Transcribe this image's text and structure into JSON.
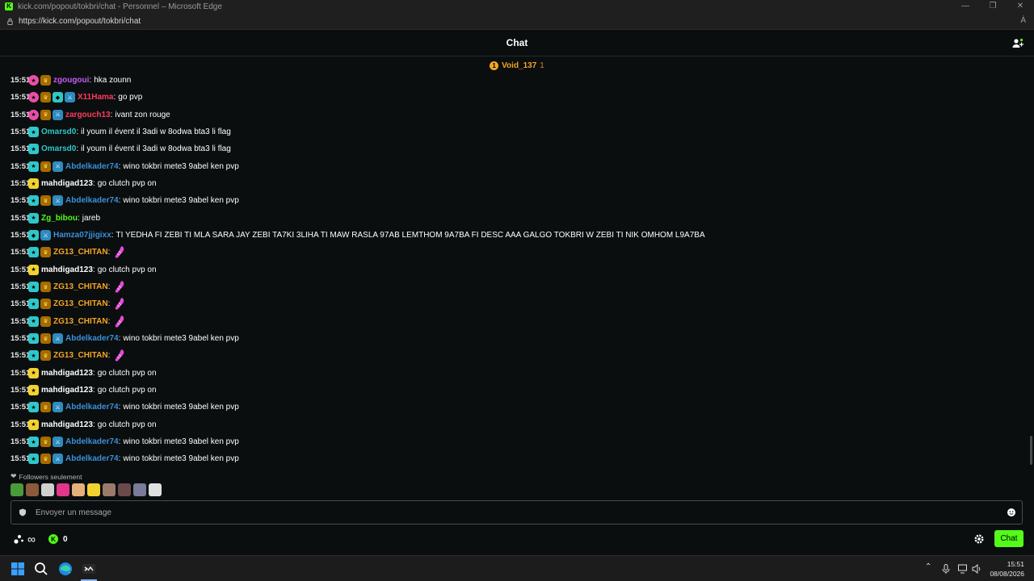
{
  "window": {
    "title": "kick.com/popout/tokbri/chat - Personnel – Microsoft Edge",
    "url": "https://kick.com/popout/tokbri/chat",
    "reader_label": "Á"
  },
  "header": {
    "title": "Chat"
  },
  "pinned": {
    "badge": "1",
    "user": "Void_137",
    "count": "1"
  },
  "colors": {
    "accent": "#53fc18",
    "purple": "#c45bf6",
    "blue": "#3b8fd9",
    "red": "#ff3b5c",
    "teal": "#2fc7c9",
    "orange": "#f5a623",
    "white": "#ffffff"
  },
  "messages": [
    {
      "time": "15:51",
      "badges": [
        "sub-pink",
        "crown"
      ],
      "user": "zgougoui",
      "color": "#c45bf6",
      "text": "hka zounn"
    },
    {
      "time": "15:51",
      "badges": [
        "sub-pink",
        "crown",
        "vip",
        "mod"
      ],
      "user": "X11Hama",
      "color": "#ff3b5c",
      "text": "go pvp"
    },
    {
      "time": "15:51",
      "badges": [
        "sub-pink",
        "crown",
        "mod"
      ],
      "user": "zargouch13",
      "color": "#ff3b5c",
      "text": "ivant zon rouge"
    },
    {
      "time": "15:51",
      "badges": [
        "sub-teal"
      ],
      "user": "Omarsd0",
      "color": "#2fc7c9",
      "text": "il youm il évent il 3adi w 8odwa bta3 li flag"
    },
    {
      "time": "15:51",
      "badges": [
        "sub-teal"
      ],
      "user": "Omarsd0",
      "color": "#2fc7c9",
      "text": "il youm il évent il 3adi w 8odwa bta3 li flag"
    },
    {
      "time": "15:51",
      "badges": [
        "sub-teal",
        "crown",
        "mod"
      ],
      "user": "Abdelkader74",
      "color": "#3b8fd9",
      "text": "wino tokbri mete3 9abel ken pvp"
    },
    {
      "time": "15:51",
      "badges": [
        "sub-yellow"
      ],
      "user": "mahdigad123",
      "color": "#ffffff",
      "text": "go clutch pvp on"
    },
    {
      "time": "15:51",
      "badges": [
        "sub-teal",
        "crown",
        "mod"
      ],
      "user": "Abdelkader74",
      "color": "#3b8fd9",
      "text": "wino tokbri mete3 9abel ken pvp"
    },
    {
      "time": "15:51",
      "badges": [
        "sub-teal"
      ],
      "user": "Zg_bibou",
      "color": "#53fc18",
      "text": "jareb"
    },
    {
      "time": "15:51",
      "badges": [
        "vip",
        "mod"
      ],
      "user": "Hamza07jjigixx",
      "color": "#3b8fd9",
      "text": "TI YEDHA FI ZEBI TI MLA SARA JAY ZEBI TA7KI 3LIHA TI MAW RASLA 97AB LEMTHOM 9A7BA FI DESC AAA GALGO TOKBRI W ZEBI TI NIK OMHOM L9A7BA"
    },
    {
      "time": "15:51",
      "badges": [
        "sub-teal",
        "crown"
      ],
      "user": "ZG13_CHITAN",
      "color": "#f5a623",
      "text": "",
      "emote": true
    },
    {
      "time": "15:51",
      "badges": [
        "sub-yellow"
      ],
      "user": "mahdigad123",
      "color": "#ffffff",
      "text": "go clutch pvp on"
    },
    {
      "time": "15:51",
      "badges": [
        "sub-teal",
        "crown"
      ],
      "user": "ZG13_CHITAN",
      "color": "#f5a623",
      "text": "",
      "emote": true
    },
    {
      "time": "15:51",
      "badges": [
        "sub-teal",
        "crown"
      ],
      "user": "ZG13_CHITAN",
      "color": "#f5a623",
      "text": "",
      "emote": true
    },
    {
      "time": "15:51",
      "badges": [
        "sub-teal",
        "crown"
      ],
      "user": "ZG13_CHITAN",
      "color": "#f5a623",
      "text": "",
      "emote": true
    },
    {
      "time": "15:51",
      "badges": [
        "sub-teal",
        "crown",
        "mod"
      ],
      "user": "Abdelkader74",
      "color": "#3b8fd9",
      "text": "wino tokbri mete3 9abel ken pvp"
    },
    {
      "time": "15:51",
      "badges": [
        "sub-teal",
        "crown"
      ],
      "user": "ZG13_CHITAN",
      "color": "#f5a623",
      "text": "",
      "emote": true
    },
    {
      "time": "15:51",
      "badges": [
        "sub-yellow"
      ],
      "user": "mahdigad123",
      "color": "#ffffff",
      "text": "go clutch pvp on"
    },
    {
      "time": "15:51",
      "badges": [
        "sub-yellow"
      ],
      "user": "mahdigad123",
      "color": "#ffffff",
      "text": "go clutch pvp on"
    },
    {
      "time": "15:51",
      "badges": [
        "sub-teal",
        "crown",
        "mod"
      ],
      "user": "Abdelkader74",
      "color": "#3b8fd9",
      "text": "wino tokbri mete3 9abel ken pvp"
    },
    {
      "time": "15:51",
      "badges": [
        "sub-yellow"
      ],
      "user": "mahdigad123",
      "color": "#ffffff",
      "text": "go clutch pvp on"
    },
    {
      "time": "15:51",
      "badges": [
        "sub-teal",
        "crown",
        "mod"
      ],
      "user": "Abdelkader74",
      "color": "#3b8fd9",
      "text": "wino tokbri mete3 9abel ken pvp"
    },
    {
      "time": "15:51",
      "badges": [
        "sub-teal",
        "crown",
        "mod"
      ],
      "user": "Abdelkader74",
      "color": "#3b8fd9",
      "text": "wino tokbri mete3 9abel ken pvp"
    }
  ],
  "followers_only": "Followers seulement",
  "emote_bar": [
    "#4a9a3a",
    "#8a5a3a",
    "#d0d0d0",
    "#e2368a",
    "#e6b07a",
    "#f2d22f",
    "#9a7a6a",
    "#6a4a4a",
    "#7a7a9a",
    "#e0e0e0"
  ],
  "input": {
    "placeholder": "Envoyer un message",
    "value": ""
  },
  "footer": {
    "points": "∞",
    "kick_count": "0",
    "chat_button": "Chat"
  },
  "taskbar": {
    "time": "15:51",
    "date": "08/08/2026"
  }
}
